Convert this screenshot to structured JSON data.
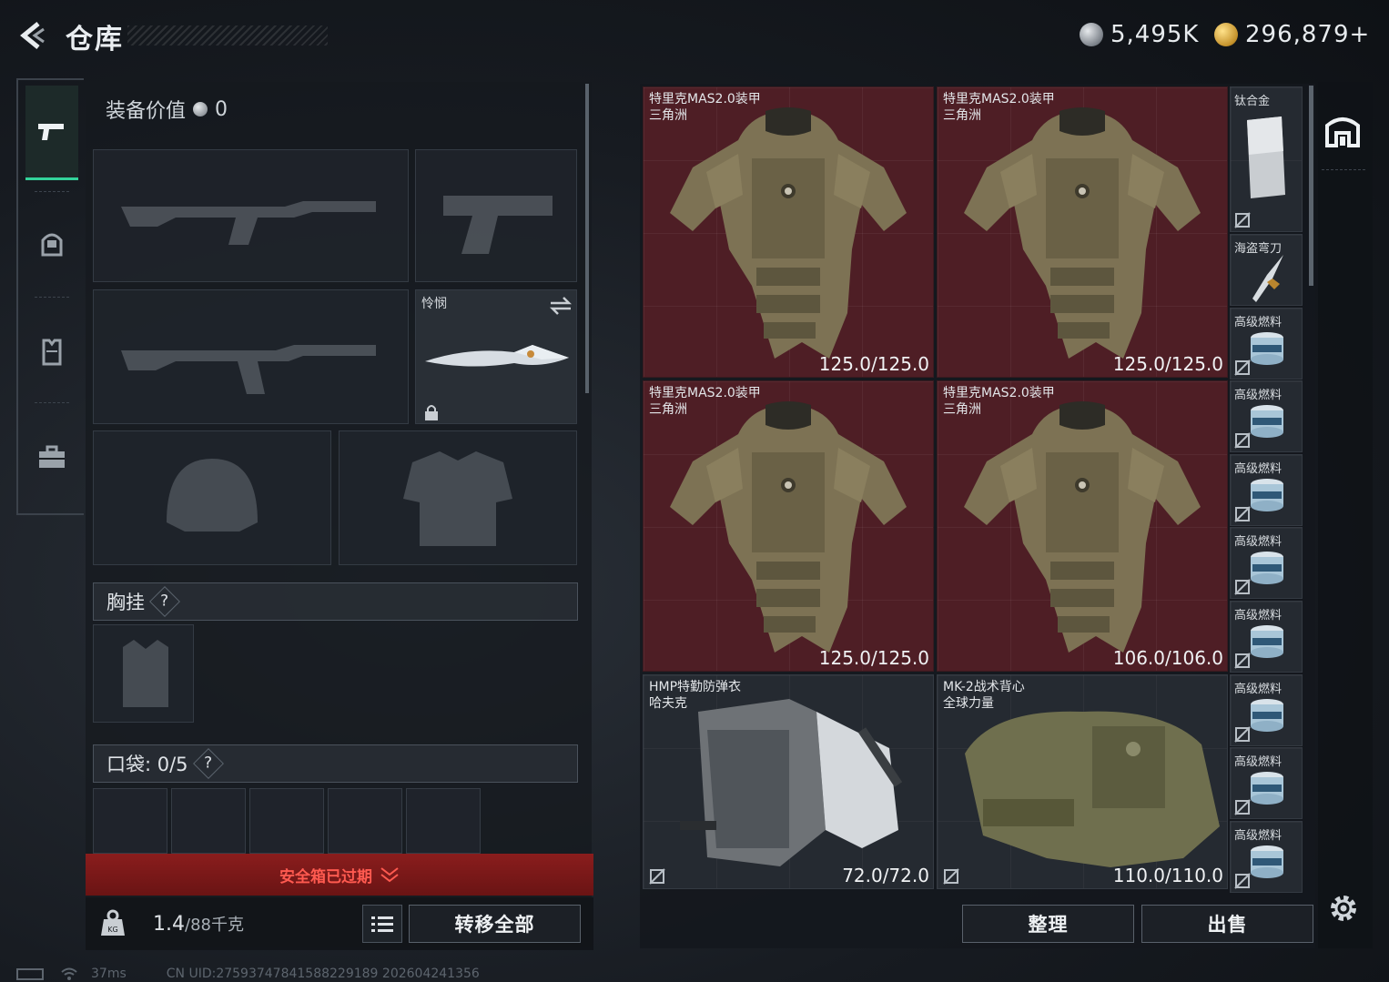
{
  "header": {
    "title": "仓库",
    "back_icon": "back-arrow-icon"
  },
  "currency": [
    {
      "icon": "silver-coin-icon",
      "value": "5,495K"
    },
    {
      "icon": "gold-coin-icon",
      "value": "296,879+"
    }
  ],
  "side_nav": [
    {
      "icon": "pistol-icon",
      "active": true
    },
    {
      "icon": "helmet-icon",
      "active": false
    },
    {
      "icon": "vest-icon",
      "active": false
    },
    {
      "icon": "briefcase-icon",
      "active": false
    }
  ],
  "loadout": {
    "equip_value_label": "装备价值",
    "equip_value": "0",
    "melee_name": "怜悯",
    "chest_rig_label": "胸挂",
    "chest_help": "?",
    "pocket_label": "口袋: 0/5",
    "pocket_help": "?",
    "safebox_status": "安全箱已过期",
    "weight_current": "1.4",
    "weight_max": "/88千克",
    "transfer_all": "转移全部"
  },
  "stash": {
    "large_items": [
      {
        "name": "特里克MAS2.0装甲",
        "brand": "三角洲",
        "durability": "125.0/125.0",
        "color": "#4e1e25"
      },
      {
        "name": "特里克MAS2.0装甲",
        "brand": "三角洲",
        "durability": "125.0/125.0",
        "color": "#4e1e25"
      },
      {
        "name": "特里克MAS2.0装甲",
        "brand": "三角洲",
        "durability": "125.0/125.0",
        "color": "#4e1e25"
      },
      {
        "name": "特里克MAS2.0装甲",
        "brand": "三角洲",
        "durability": "106.0/106.0",
        "color": "#4e1e25"
      },
      {
        "name": "HMP特勤防弹衣",
        "brand": "哈夫克",
        "durability": "72.0/72.0",
        "color": "#252a31"
      },
      {
        "name": "MK-2战术背心",
        "brand": "全球力量",
        "durability": "110.0/110.0",
        "color": "#252a31"
      }
    ],
    "small_items": [
      {
        "name": "钛合金"
      },
      {
        "name": "海盗弯刀"
      },
      {
        "name": "高级燃料"
      },
      {
        "name": "高级燃料"
      },
      {
        "name": "高级燃料"
      },
      {
        "name": "高级燃料"
      },
      {
        "name": "高级燃料"
      },
      {
        "name": "高级燃料"
      },
      {
        "name": "高级燃料"
      },
      {
        "name": "高级燃料"
      }
    ],
    "sort_label": "整理",
    "sell_label": "出售"
  },
  "footer": {
    "ping": "37ms",
    "uid": "CN UID:2759374784158822918​9 202604241356"
  },
  "colors": {
    "accent_green": "#33d39a",
    "rare_red": "#4e1e25",
    "warning_red": "#ff5a50"
  }
}
